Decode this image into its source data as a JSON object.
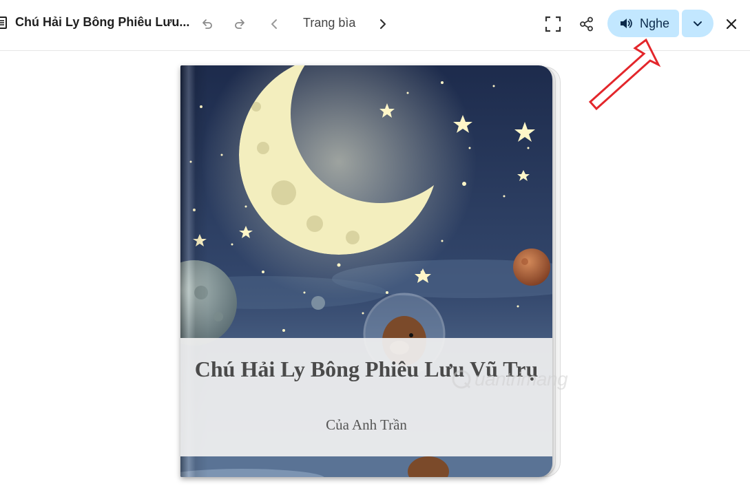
{
  "header": {
    "doc_title": "Chú Hải Ly Bông Phiêu Lưu...",
    "page_label": "Trang bìa",
    "listen_label": "Nghe"
  },
  "icons": {
    "doc": "document-icon",
    "undo": "undo-icon",
    "redo": "redo-icon",
    "prev": "chevron-left-icon",
    "next": "chevron-right-icon",
    "fullscreen": "fullscreen-icon",
    "share": "share-icon",
    "speaker": "speaker-icon",
    "more": "chevron-down-icon",
    "close": "close-icon"
  },
  "book": {
    "title": "Chú Hải Ly Bông Phiêu Lưu Vũ Trụ",
    "author": "Của Anh Trần"
  },
  "watermark": {
    "text": "uantrimang"
  },
  "colors": {
    "listen_bg": "#c2e7ff",
    "sky_top": "#1d2b4c",
    "sky_bottom": "#5d7596",
    "moon": "#f3eebe",
    "annotation": "#e3262b"
  }
}
